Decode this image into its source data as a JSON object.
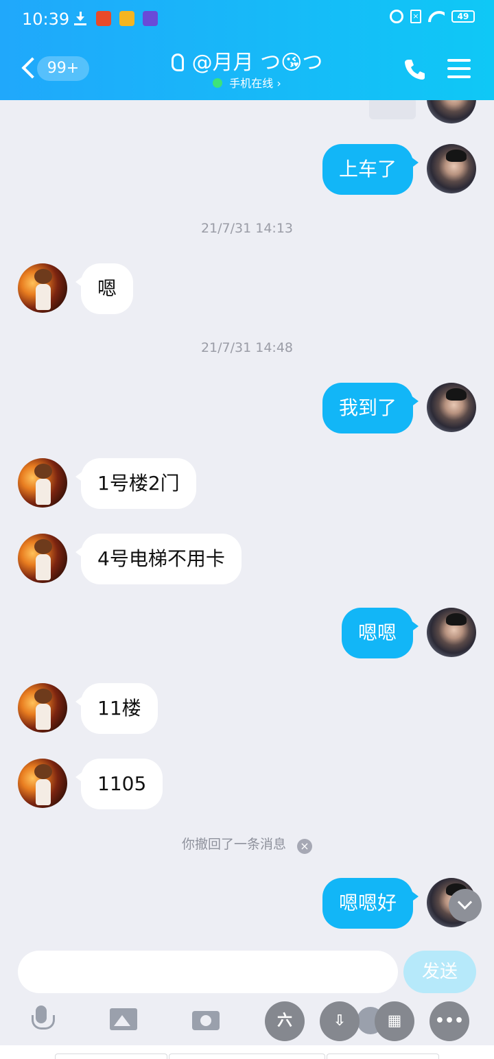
{
  "status_bar": {
    "time": "10:39",
    "battery": "49"
  },
  "header": {
    "unread_count": "99+",
    "contact_name": "@月月 つ😘つ",
    "online_status": "手机在线 ›"
  },
  "messages": [
    {
      "side": "me",
      "text": "上车了"
    },
    {
      "type": "time",
      "text": "21/7/31 14:13"
    },
    {
      "side": "them",
      "text": "嗯"
    },
    {
      "type": "time",
      "text": "21/7/31 14:48"
    },
    {
      "side": "me",
      "text": "我到了"
    },
    {
      "side": "them",
      "text": "1号楼2门"
    },
    {
      "side": "them",
      "text": "4号电梯不用卡"
    },
    {
      "side": "me",
      "text": "嗯嗯"
    },
    {
      "side": "them",
      "text": "11楼"
    },
    {
      "side": "them",
      "text": "1105"
    },
    {
      "type": "system",
      "text": "你撤回了一条消息"
    },
    {
      "side": "me",
      "text": "嗯嗯好"
    }
  ],
  "input": {
    "value": "",
    "send_label": "发送"
  },
  "toolbar": {
    "icons": [
      "mic-icon",
      "image-icon",
      "camera-icon",
      "red-packet-icon",
      "save-icon",
      "emoji-icon",
      "grid-icon",
      "more-icon"
    ]
  },
  "colors": {
    "header_start": "#20a8fb",
    "header_end": "#0fc8f6",
    "my_bubble": "#12b6f7",
    "their_bubble": "#ffffff",
    "background": "#edeef4"
  }
}
